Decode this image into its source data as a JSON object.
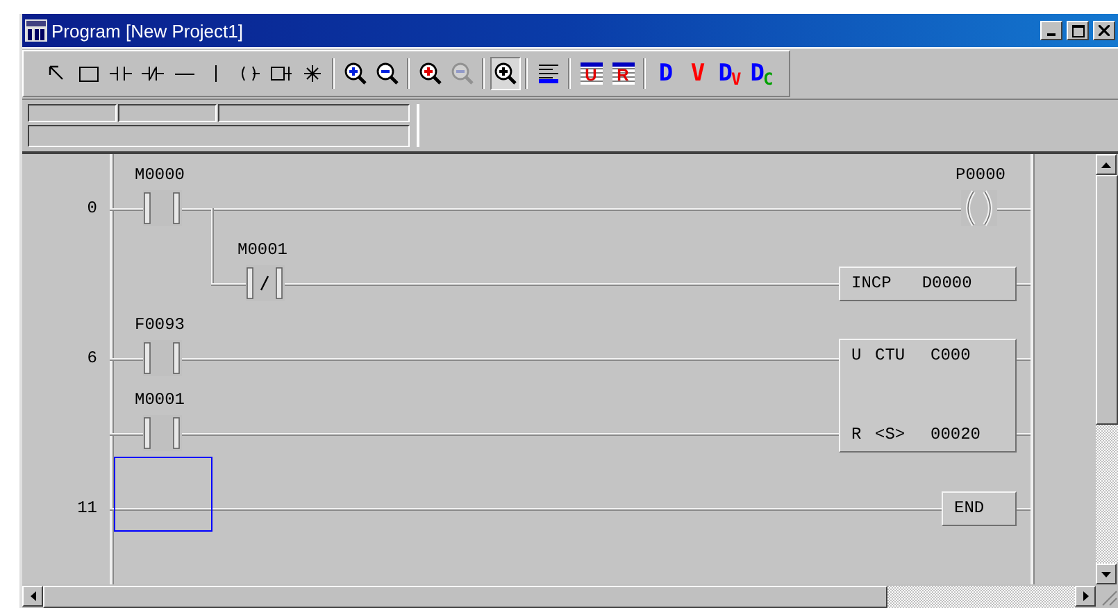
{
  "window": {
    "title": "Program [New Project1]"
  },
  "toolbar": [
    {
      "kind": "pointer",
      "pressed": false,
      "disabled": false
    },
    {
      "kind": "rect",
      "pressed": false,
      "disabled": false
    },
    {
      "kind": "contact",
      "pressed": false,
      "disabled": false
    },
    {
      "kind": "contact_nc",
      "pressed": false,
      "disabled": false
    },
    {
      "kind": "hline",
      "pressed": false,
      "disabled": false
    },
    {
      "kind": "vline",
      "pressed": false,
      "disabled": false
    },
    {
      "kind": "coil",
      "pressed": false,
      "disabled": false
    },
    {
      "kind": "box",
      "pressed": false,
      "disabled": false
    },
    {
      "kind": "star",
      "pressed": false,
      "disabled": false
    },
    {
      "kind": "separator"
    },
    {
      "kind": "zoom_in",
      "pressed": false,
      "disabled": false
    },
    {
      "kind": "zoom_out",
      "pressed": false,
      "disabled": false
    },
    {
      "kind": "separator"
    },
    {
      "kind": "zoom_in_red",
      "pressed": false,
      "disabled": false
    },
    {
      "kind": "zoom_out",
      "pressed": false,
      "disabled": true
    },
    {
      "kind": "separator"
    },
    {
      "kind": "zoom_fit",
      "pressed": true,
      "disabled": false
    },
    {
      "kind": "separator"
    },
    {
      "kind": "align",
      "pressed": false,
      "disabled": false
    },
    {
      "kind": "separator"
    },
    {
      "kind": "table",
      "label": "U",
      "pressed": false,
      "disabled": false
    },
    {
      "kind": "table",
      "label": "R",
      "pressed": false,
      "disabled": false
    },
    {
      "kind": "separator"
    },
    {
      "kind": "letter",
      "parts": [
        {
          "text": "D",
          "color": "#0000ff"
        }
      ],
      "pressed": false,
      "disabled": false
    },
    {
      "kind": "letter",
      "parts": [
        {
          "text": "V",
          "color": "#ff0000"
        }
      ],
      "pressed": false,
      "disabled": false
    },
    {
      "kind": "letter",
      "parts": [
        {
          "text": "D",
          "color": "#0000ff"
        },
        {
          "text": "V",
          "color": "#ff0000"
        }
      ],
      "pressed": false,
      "disabled": false
    },
    {
      "kind": "letter",
      "parts": [
        {
          "text": "D",
          "color": "#0000ff"
        },
        {
          "text": "C",
          "color": "#00a000"
        }
      ],
      "pressed": false,
      "disabled": false
    }
  ],
  "lines": [
    {
      "step": "0",
      "contacts": [
        {
          "kind": "no",
          "label": "M0000"
        }
      ],
      "output": {
        "kind": "coil",
        "label": "P0000"
      }
    },
    {
      "branch": true,
      "contacts": [
        {
          "kind": "nc",
          "label": "M0001"
        }
      ],
      "output": {
        "kind": "instruction",
        "cells": [
          "INCP",
          "D0000"
        ]
      }
    },
    {
      "step": "6",
      "contacts": [
        {
          "kind": "no",
          "label": "F0093"
        }
      ],
      "output": {
        "kind": "counter",
        "cells": [
          "U",
          "CTU",
          "C000"
        ],
        "reset_cells": [
          "R",
          "<S>",
          "00020"
        ]
      }
    },
    {
      "contacts": [
        {
          "kind": "no",
          "label": "M0001"
        }
      ]
    },
    {
      "step": "11",
      "cursor": true,
      "output": {
        "kind": "end",
        "cells": [
          "END"
        ]
      }
    }
  ]
}
